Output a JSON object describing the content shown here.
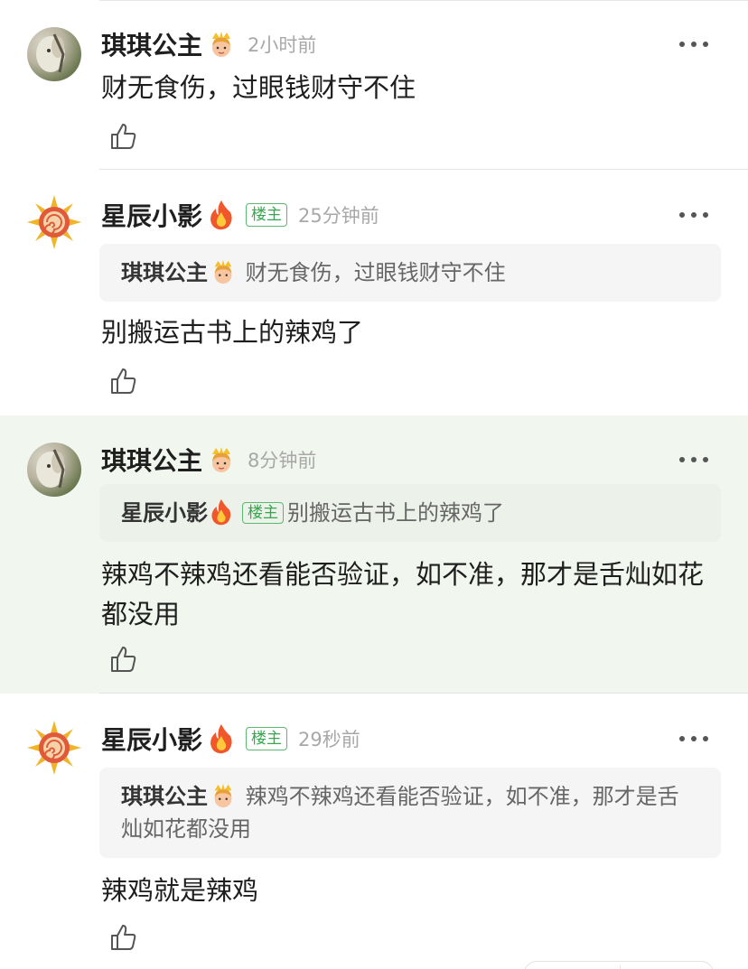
{
  "comments": [
    {
      "user": "琪琪公主",
      "badge": "princess-emoji",
      "time": "2小时前",
      "text": "财无食伤，过眼钱财守不住"
    },
    {
      "user": "星辰小影",
      "badge": "fire-emoji",
      "op_tag": "楼主",
      "time": "25分钟前",
      "quote_user": "琪琪公主",
      "quote_text": "财无食伤，过眼钱财守不住",
      "text": "别搬运古书上的辣鸡了"
    },
    {
      "user": "琪琪公主",
      "badge": "princess-emoji",
      "time": "8分钟前",
      "quote_user": "星辰小影",
      "quote_tag": "楼主",
      "quote_text": "别搬运古书上的辣鸡了",
      "text": "辣鸡不辣鸡还看能否验证，如不准，那才是舌灿如花都没用"
    },
    {
      "user": "星辰小影",
      "badge": "fire-emoji",
      "op_tag": "楼主",
      "time": "29秒前",
      "quote_user": "琪琪公主",
      "quote_text": "辣鸡不辣鸡还看能否验证，如不准，那才是舌灿如花都没用",
      "text": "辣鸡就是辣鸡"
    }
  ],
  "colors": {
    "highlight_bg": "#f1f6ee",
    "op_tag_green": "#36a64f",
    "time_gray": "#a8a8a8"
  }
}
